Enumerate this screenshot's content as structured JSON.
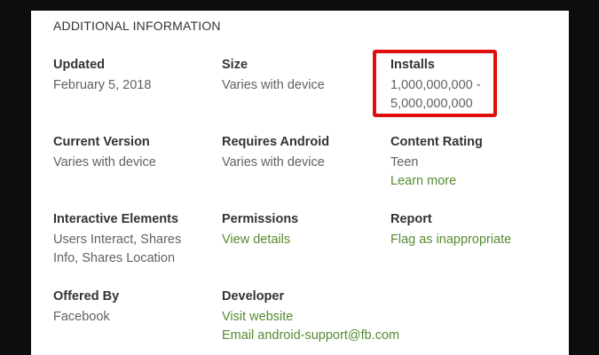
{
  "section": {
    "title": "ADDITIONAL INFORMATION"
  },
  "updated": {
    "label": "Updated",
    "value": "February 5, 2018"
  },
  "size": {
    "label": "Size",
    "value": "Varies with device"
  },
  "installs": {
    "label": "Installs",
    "value_line1": "1,000,000,000 -",
    "value_line2": "5,000,000,000"
  },
  "current_version": {
    "label": "Current Version",
    "value": "Varies with device"
  },
  "requires_android": {
    "label": "Requires Android",
    "value": "Varies with device"
  },
  "content_rating": {
    "label": "Content Rating",
    "value": "Teen",
    "link": "Learn more"
  },
  "interactive_elements": {
    "label": "Interactive Elements",
    "value_line1": "Users Interact, Shares",
    "value_line2": "Info, Shares Location"
  },
  "permissions": {
    "label": "Permissions",
    "link": "View details"
  },
  "report": {
    "label": "Report",
    "link": "Flag as inappropriate"
  },
  "offered_by": {
    "label": "Offered By",
    "value": "Facebook"
  },
  "developer": {
    "label": "Developer",
    "website_link": "Visit website",
    "email_link": "Email android-support@fb.com"
  },
  "colors": {
    "link_green": "#558b2f",
    "highlight_red": "#e00d0d",
    "label_text": "#333333",
    "value_text": "#616161"
  }
}
